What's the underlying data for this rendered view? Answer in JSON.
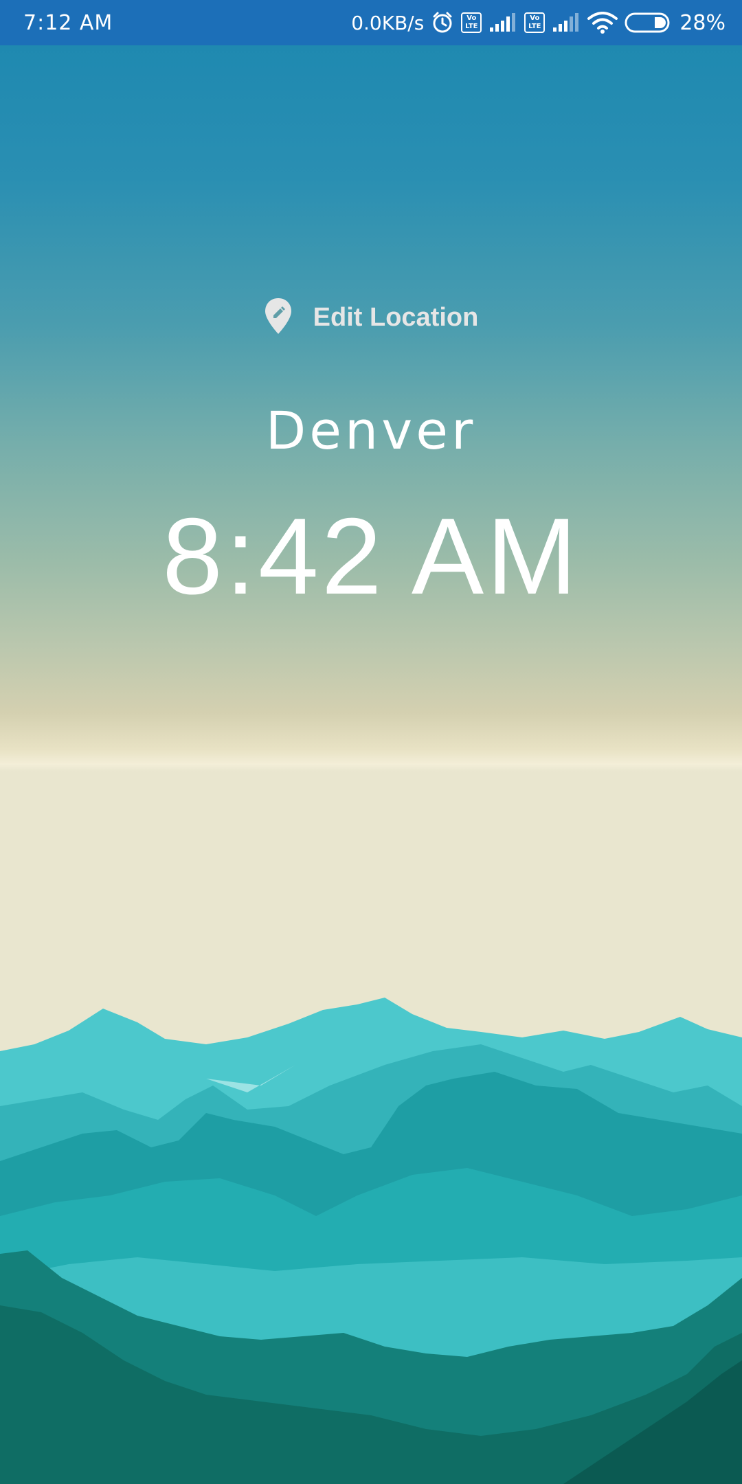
{
  "status_bar": {
    "time": "7:12 AM",
    "network_speed": "0.0KB/s",
    "alarm_icon": "alarm-icon",
    "volte_label": "Vo LTE",
    "signal_icon": "signal-icon",
    "wifi_icon": "wifi-icon",
    "battery_icon": "battery-icon",
    "battery_percent": "28%"
  },
  "location": {
    "edit_label": "Edit Location",
    "edit_icon": "location-pin-edit-icon",
    "city": "Denver",
    "time": "8:42 AM"
  },
  "colors": {
    "status_bar": "#1c6fb8",
    "sky_top": "#1b87b0",
    "sky_horizon": "#f3eed8",
    "mountain_far": "#3fc3c9",
    "mountain_mid": "#1a9fa6",
    "mountain_near": "#0e6a62"
  }
}
